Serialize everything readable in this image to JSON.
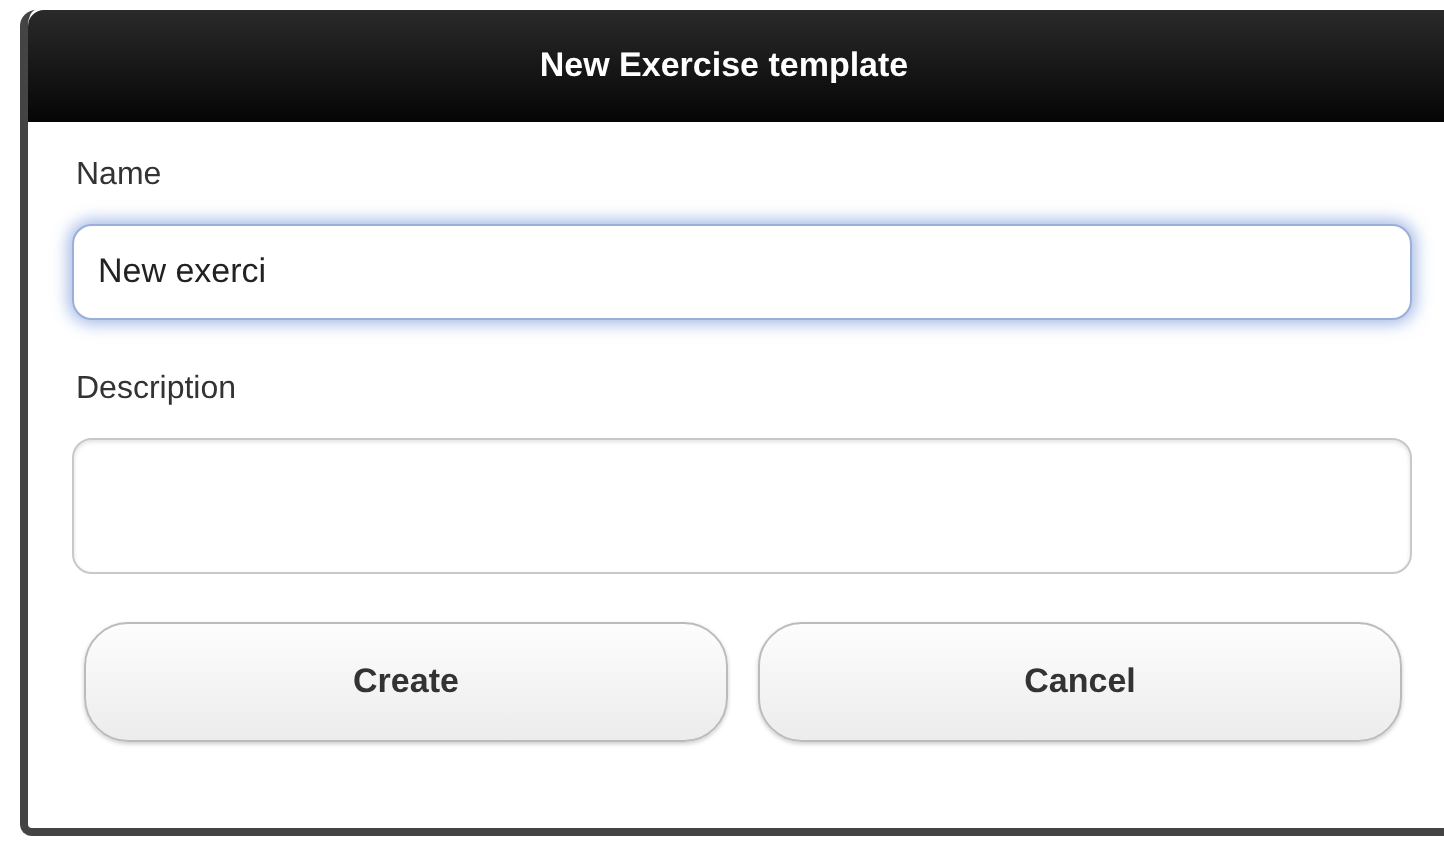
{
  "dialog": {
    "title": "New Exercise template",
    "fields": [
      {
        "label": "Name",
        "value": "New exerci",
        "focused": true,
        "kind": "line"
      },
      {
        "label": "Description",
        "focused": false,
        "kind": "area"
      }
    ],
    "buttons": [
      "Create",
      "Cancel"
    ]
  }
}
